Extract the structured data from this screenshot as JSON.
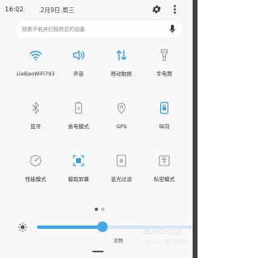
{
  "status_bar": {
    "time": "16:02",
    "date": "2月9日 周三",
    "settings_icon": "gear-icon",
    "more_icon": "more-vert-icon"
  },
  "search": {
    "placeholder": "搜索手机并扫描附近的设备",
    "mic_icon": "mic-icon"
  },
  "tiles": [
    {
      "label": "LieBaoWiFi793",
      "icon": "wifi-icon",
      "active": true
    },
    {
      "label": "声音",
      "icon": "volume-icon",
      "active": true
    },
    {
      "label": "移动数据",
      "icon": "mobile-data-icon",
      "active": true
    },
    {
      "label": "手电筒",
      "icon": "flashlight-icon",
      "active": false
    },
    {
      "label": "蓝牙",
      "icon": "bluetooth-icon",
      "active": false
    },
    {
      "label": "省电模式",
      "icon": "battery-saver-icon",
      "active": false
    },
    {
      "label": "GPS",
      "icon": "location-icon",
      "active": false
    },
    {
      "label": "纵向",
      "icon": "portrait-lock-icon",
      "active": true
    },
    {
      "label": "性能模式",
      "icon": "performance-icon",
      "active": false
    },
    {
      "label": "截取屏幕",
      "icon": "screenshot-icon",
      "active": true
    },
    {
      "label": "蓝光过滤",
      "icon": "blue-light-filter-icon",
      "active": false
    },
    {
      "label": "私密模式",
      "icon": "private-mode-icon",
      "active": false
    }
  ],
  "pager": {
    "pages": 2,
    "current": 1
  },
  "brightness": {
    "level": 0.42,
    "auto_label": "流畅"
  },
  "watermark": {
    "line1": "盖乐世社区",
    "line2": "@QQ_BF9PKU"
  },
  "colors": {
    "accent": "#2f9be3",
    "inactive": "#9a9a9a",
    "panel_bg": "#f8f8f8"
  }
}
